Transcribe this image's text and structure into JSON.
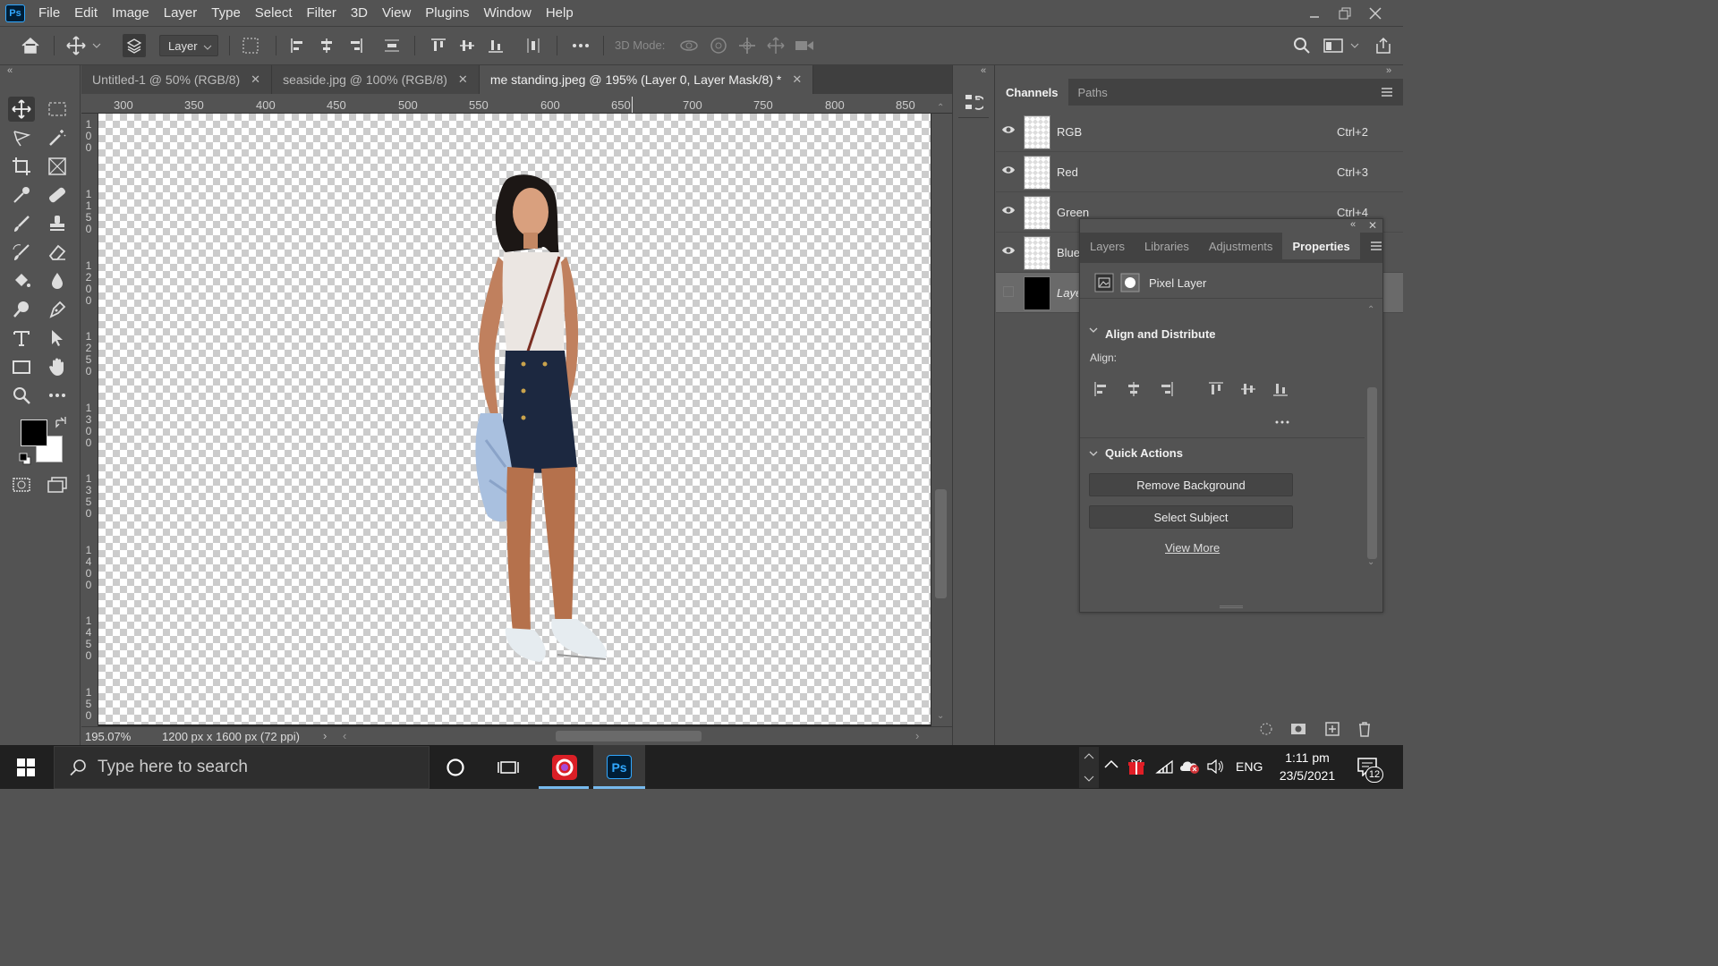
{
  "app": {
    "logo": "Ps"
  },
  "menu": [
    "File",
    "Edit",
    "Image",
    "Layer",
    "Type",
    "Select",
    "Filter",
    "3D",
    "View",
    "Plugins",
    "Window",
    "Help"
  ],
  "options_bar": {
    "auto_select_target": "Layer",
    "mode_3d_label": "3D Mode:"
  },
  "tabs": [
    {
      "label": "Untitled-1 @ 50% (RGB/8)",
      "active": false
    },
    {
      "label": "seaside.jpg @ 100% (RGB/8)",
      "active": false
    },
    {
      "label": "me standing.jpeg @ 195% (Layer 0, Layer Mask/8) *",
      "active": true
    }
  ],
  "ruler": {
    "h": [
      "300",
      "350",
      "400",
      "450",
      "500",
      "550",
      "600",
      "650",
      "700",
      "750",
      "800",
      "850"
    ],
    "v": [
      [
        "1",
        "0",
        "0"
      ],
      [
        "1",
        "1",
        "5",
        "0"
      ],
      [
        "1",
        "2",
        "0",
        "0"
      ],
      [
        "1",
        "2",
        "5",
        "0"
      ],
      [
        "1",
        "3",
        "0",
        "0"
      ],
      [
        "1",
        "3",
        "5",
        "0"
      ],
      [
        "1",
        "4",
        "0",
        "0"
      ],
      [
        "1",
        "4",
        "5",
        "0"
      ],
      [
        "1",
        "5",
        "0"
      ]
    ]
  },
  "status": {
    "zoom": "195.07%",
    "doc_info": "1200 px x 1600 px (72 ppi)"
  },
  "channels_panel": {
    "tabs": [
      "Channels",
      "Paths"
    ],
    "rows": [
      {
        "name": "RGB",
        "shortcut": "Ctrl+2"
      },
      {
        "name": "Red",
        "shortcut": "Ctrl+3"
      },
      {
        "name": "Green",
        "shortcut": "Ctrl+4"
      },
      {
        "name": "Blue",
        "shortcut": ""
      },
      {
        "name": "Layer 0 Mask",
        "shortcut": ""
      }
    ]
  },
  "properties_panel": {
    "tabs": [
      "Layers",
      "Libraries",
      "Adjustments",
      "Properties"
    ],
    "layer_kind": "Pixel Layer",
    "align_section": "Align and Distribute",
    "align_label": "Align:",
    "quick_section": "Quick Actions",
    "remove_bg": "Remove Background",
    "select_subject": "Select Subject",
    "view_more": "View More"
  },
  "taskbar": {
    "search_placeholder": "Type here to search",
    "language": "ENG",
    "time": "1:11 pm",
    "date": "23/5/2021",
    "notifications": "12"
  },
  "colors": {
    "chrome": "#535353",
    "dark": "#424242",
    "accent": "#31a8ff"
  }
}
